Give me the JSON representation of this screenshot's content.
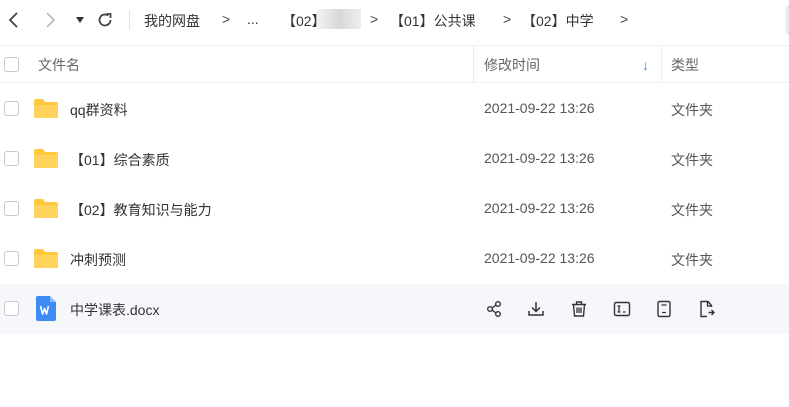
{
  "breadcrumb": {
    "items": [
      "我的网盘",
      "...",
      "【02】",
      "【01】公共课",
      "【02】中学"
    ],
    "separator": ">"
  },
  "table": {
    "headers": {
      "name": "文件名",
      "modified": "修改时间",
      "type": "类型"
    },
    "sort_indicator": "↓",
    "rows": [
      {
        "name": "qq群资料",
        "modified": "2021-09-22 13:26",
        "type": "文件夹",
        "icon": "folder-icon"
      },
      {
        "name": "【01】综合素质",
        "modified": "2021-09-22 13:26",
        "type": "文件夹",
        "icon": "folder-icon"
      },
      {
        "name": "【02】教育知识与能力",
        "modified": "2021-09-22 13:26",
        "type": "文件夹",
        "icon": "folder-icon"
      },
      {
        "name": "冲刺预测",
        "modified": "2021-09-22 13:26",
        "type": "文件夹",
        "icon": "folder-icon"
      },
      {
        "name": "中学课表.docx",
        "icon": "word-doc-icon"
      }
    ],
    "hover_actions": [
      "share-icon",
      "download-icon",
      "delete-icon",
      "rename-icon",
      "copy-icon",
      "move-icon"
    ]
  },
  "colors": {
    "folder": "#ffc83d",
    "word": "#3e8bf5",
    "accent": "#2b8cf0",
    "hover_row": "#f5f7fb"
  }
}
